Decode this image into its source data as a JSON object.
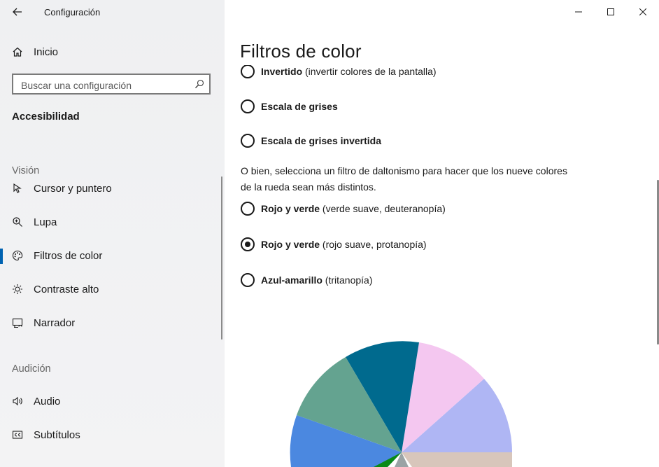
{
  "window": {
    "title": "Configuración"
  },
  "sidebar": {
    "home_label": "Inicio",
    "search_placeholder": "Buscar una configuración",
    "section_title": "Accesibilidad",
    "groups": [
      {
        "label": "Visión",
        "items": [
          {
            "label": "Cursor y puntero",
            "icon": "cursor-pointer-icon"
          },
          {
            "label": "Lupa",
            "icon": "magnifier-icon"
          },
          {
            "label": "Filtros de color",
            "icon": "palette-icon",
            "selected": true
          },
          {
            "label": "Contraste alto",
            "icon": "brightness-icon"
          },
          {
            "label": "Narrador",
            "icon": "narrator-icon"
          }
        ]
      },
      {
        "label": "Audición",
        "items": [
          {
            "label": "Audio",
            "icon": "speaker-icon"
          },
          {
            "label": "Subtítulos",
            "icon": "closed-captions-icon"
          }
        ]
      }
    ]
  },
  "main": {
    "page_title": "Filtros de color",
    "filters": [
      {
        "name": "Invertido",
        "detail": "(invertir colores de la pantalla)",
        "checked": false
      },
      {
        "name": "Escala de grises",
        "detail": "",
        "checked": false
      },
      {
        "name": "Escala de grises invertida",
        "detail": "",
        "checked": false
      }
    ],
    "colorblind_description": "O bien, selecciona un filtro de daltonismo para hacer que los nueve colores de la rueda sean más distintos.",
    "colorblind_filters": [
      {
        "name": "Rojo y verde",
        "detail": "(verde suave, deuteranopía)",
        "checked": false
      },
      {
        "name": "Rojo y verde",
        "detail": "(rojo suave, protanopía)",
        "checked": true
      },
      {
        "name": "Azul-amarillo",
        "detail": "(tritanopía)",
        "checked": false
      }
    ],
    "color_wheel": {
      "colors": [
        "#afb6f4",
        "#f4c7f0",
        "#006a8e",
        "#64a390",
        "#4b88e0",
        "#0a8a16",
        "#9aa3a5",
        "#d8c6bb"
      ]
    }
  }
}
